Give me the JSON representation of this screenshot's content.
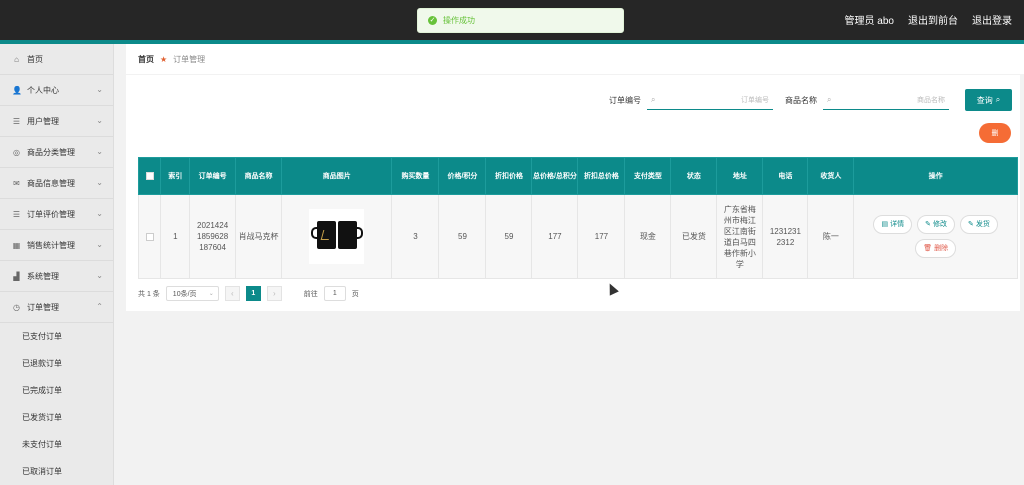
{
  "toast": {
    "text": "操作成功"
  },
  "topnav": {
    "admin": "管理员 abo",
    "back": "退出到前台",
    "logout": "退出登录"
  },
  "sidebar": {
    "items": [
      {
        "label": "首页",
        "icon": "home-icon",
        "glyph": "⌂"
      },
      {
        "label": "个人中心",
        "icon": "user-icon",
        "glyph": "👤"
      },
      {
        "label": "用户管理",
        "icon": "users-icon",
        "glyph": "☰"
      },
      {
        "label": "商品分类管理",
        "icon": "category-icon",
        "glyph": "◎"
      },
      {
        "label": "商品信息管理",
        "icon": "mail-icon",
        "glyph": "✉"
      },
      {
        "label": "订单评价管理",
        "icon": "review-icon",
        "glyph": "☰"
      },
      {
        "label": "销售统计管理",
        "icon": "stats-icon",
        "glyph": "▦"
      },
      {
        "label": "系统管理",
        "icon": "system-icon",
        "glyph": "▟"
      },
      {
        "label": "订单管理",
        "icon": "order-icon",
        "glyph": "◷"
      }
    ],
    "subitems": [
      "已支付订单",
      "已退款订单",
      "已完成订单",
      "已发货订单",
      "未支付订单",
      "已取消订单"
    ]
  },
  "breadcrumb": {
    "home": "首页",
    "current": "订单管理"
  },
  "search": {
    "order_label": "订单编号",
    "order_placeholder": "订单编号",
    "name_label": "商品名称",
    "name_placeholder": "商品名称",
    "query_button": "查询"
  },
  "delete_button": "删",
  "table": {
    "headers": [
      "索引",
      "订单编号",
      "商品名称",
      "商品图片",
      "购买数量",
      "价格/积分",
      "折扣价格",
      "总价格/总积分",
      "折扣总价格",
      "支付类型",
      "状态",
      "地址",
      "电话",
      "收货人",
      "操作"
    ],
    "rows": [
      {
        "index": "1",
        "order_no": "2021424 1859628 187604",
        "name": "肖战马克杯",
        "qty": "3",
        "price": "59",
        "discount_price": "59",
        "total": "177",
        "discount_total": "177",
        "pay_type": "现金",
        "status": "已发货",
        "address": "广东省梅州市梅江区江南街道白马四巷作新小学",
        "phone": "1231231 2312",
        "receiver": "陈一"
      }
    ],
    "ops": {
      "detail": "详情",
      "edit": "修改",
      "ship": "发货",
      "delete": "删除"
    }
  },
  "pager": {
    "total": "共 1 条",
    "page_size": "10条/页",
    "page": "1",
    "goto_label": "前往",
    "goto_value": "1",
    "page_suffix": "页"
  }
}
